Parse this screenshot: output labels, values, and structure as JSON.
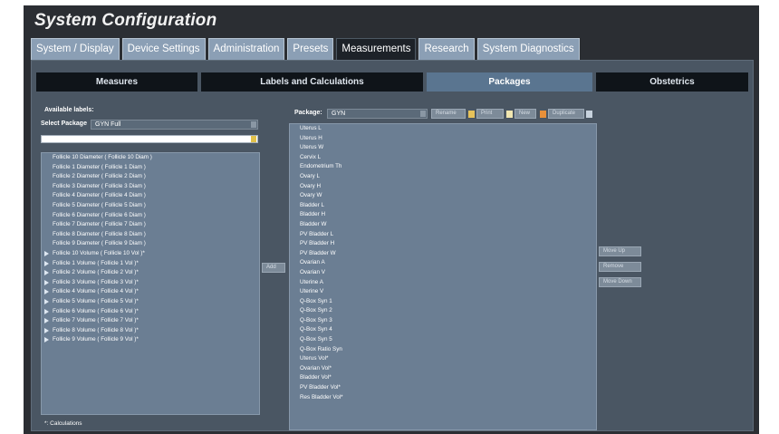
{
  "title": "System Configuration",
  "tabs": [
    "System / Display",
    "Device Settings",
    "Administration",
    "Presets",
    "Measurements",
    "Research",
    "System Diagnostics"
  ],
  "subtabs": [
    "Measures",
    "Labels and Calculations",
    "Packages",
    "Obstetrics"
  ],
  "left": {
    "available_label": "Available labels:",
    "select_package_label": "Select Package",
    "select_package_value": "GYN Full",
    "search_value": "",
    "items": [
      {
        "text": "Follicle 10 Diameter ( Follicle 10 Diam )",
        "expandable": false
      },
      {
        "text": "Follicle 1 Diameter ( Follicle 1 Diam )",
        "expandable": false
      },
      {
        "text": "Follicle 2 Diameter ( Follicle 2 Diam )",
        "expandable": false
      },
      {
        "text": "Follicle 3 Diameter ( Follicle 3 Diam )",
        "expandable": false
      },
      {
        "text": "Follicle 4 Diameter ( Follicle 4 Diam )",
        "expandable": false
      },
      {
        "text": "Follicle 5 Diameter ( Follicle 5 Diam )",
        "expandable": false
      },
      {
        "text": "Follicle 6 Diameter ( Follicle 6 Diam )",
        "expandable": false
      },
      {
        "text": "Follicle 7 Diameter ( Follicle 7 Diam )",
        "expandable": false
      },
      {
        "text": "Follicle 8 Diameter ( Follicle 8 Diam )",
        "expandable": false
      },
      {
        "text": "Follicle 9 Diameter ( Follicle 9 Diam )",
        "expandable": false
      },
      {
        "text": "Follicle 10 Volume ( Follicle 10 Vol )*",
        "expandable": true
      },
      {
        "text": "Follicle 1 Volume ( Follicle 1 Vol )*",
        "expandable": true
      },
      {
        "text": "Follicle 2 Volume ( Follicle 2 Vol )*",
        "expandable": true
      },
      {
        "text": "Follicle 3 Volume ( Follicle 3 Vol )*",
        "expandable": true
      },
      {
        "text": "Follicle 4 Volume ( Follicle 4 Vol )*",
        "expandable": true
      },
      {
        "text": "Follicle 5 Volume ( Follicle 5 Vol )*",
        "expandable": true
      },
      {
        "text": "Follicle 6 Volume ( Follicle 6 Vol )*",
        "expandable": true
      },
      {
        "text": "Follicle 7 Volume ( Follicle 7 Vol )*",
        "expandable": true
      },
      {
        "text": "Follicle 8 Volume ( Follicle 8 Vol )*",
        "expandable": true
      },
      {
        "text": "Follicle 9 Volume ( Follicle 9 Vol )*",
        "expandable": true
      }
    ],
    "footer": "*: Calculations"
  },
  "middle": {
    "add_button": "Add",
    "package_label": "Package:",
    "package_value": "GYN",
    "rename": "Rename",
    "print": "Print",
    "new": "New",
    "duplicate": "Duplicate",
    "items": [
      "Uterus L",
      "Uterus H",
      "Uterus W",
      "Cervix L",
      "Endometrium Th",
      "Ovary L",
      "Ovary H",
      "Ovary W",
      "Bladder L",
      "Bladder H",
      "Bladder W",
      "PV Bladder L",
      "PV Bladder H",
      "PV Bladder W",
      "Ovarian A",
      "Ovarian V",
      "Uterine A",
      "Uterine V",
      "Q-Box Syn 1",
      "Q-Box Syn 2",
      "Q-Box Syn 3",
      "Q-Box Syn 4",
      "Q-Box Syn 5",
      "Q-Box Ratio Syn",
      "Uterus Vol*",
      "Ovarian Vol*",
      "Bladder Vol*",
      "PV Bladder Vol*",
      "Res Bladder Vol*"
    ]
  },
  "right": {
    "move_up": "Move Up",
    "remove": "Remove",
    "move_down": "Move Down"
  },
  "colors": {
    "background": "#2b2e33",
    "active_subtab": "#5a7590",
    "list_panel": "#6b7e93"
  }
}
